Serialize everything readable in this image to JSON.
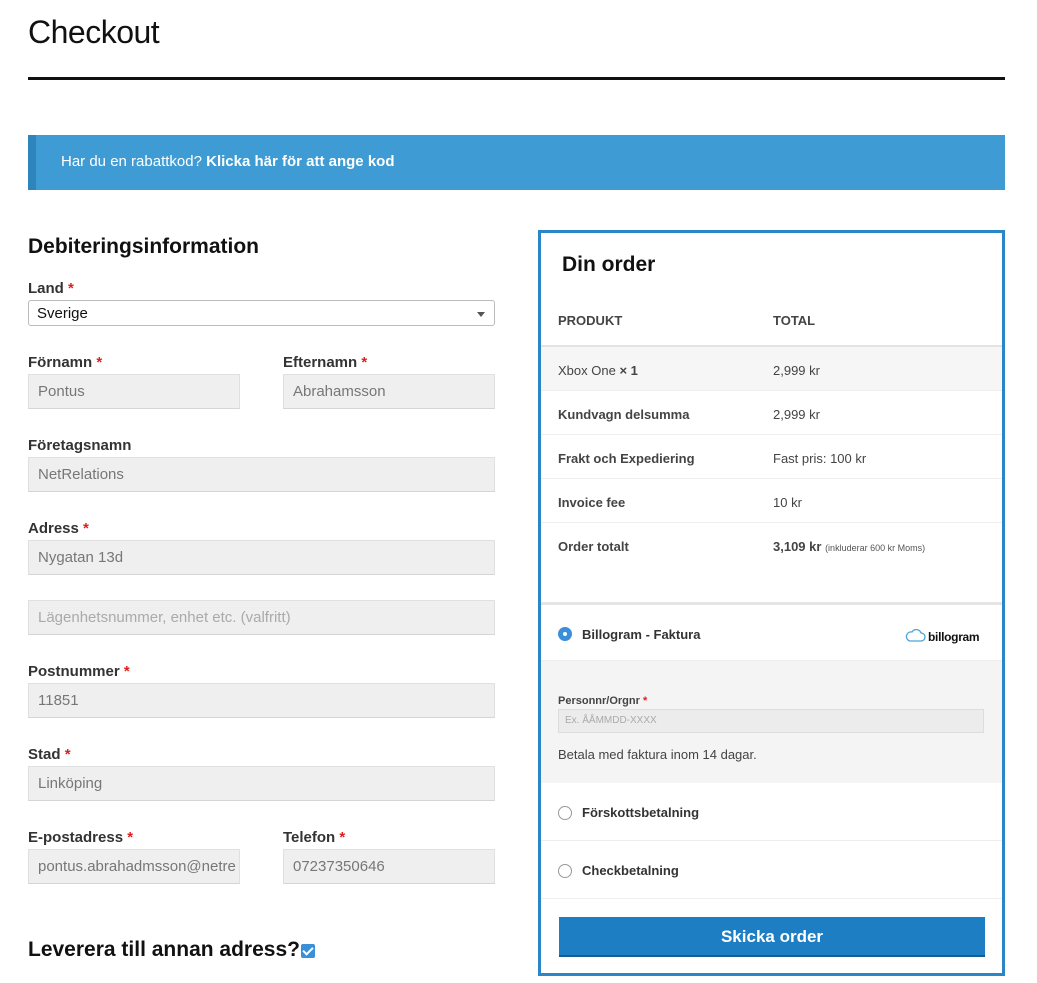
{
  "page": {
    "title": "Checkout"
  },
  "coupon": {
    "text": "Har du en rabattkod?",
    "link": "Klicka här för att ange kod"
  },
  "billing": {
    "heading": "Debiteringsinformation",
    "required_mark": "*",
    "country": {
      "label": "Land",
      "value": "Sverige"
    },
    "first_name": {
      "label": "Förnamn",
      "value": "Pontus"
    },
    "last_name": {
      "label": "Efternamn",
      "value": "Abrahamsson"
    },
    "company": {
      "label": "Företagsnamn",
      "value": "NetRelations"
    },
    "address": {
      "label": "Adress",
      "value": "Nygatan 13d"
    },
    "address2": {
      "placeholder": "Lägenhetsnummer, enhet etc. (valfritt)"
    },
    "postcode": {
      "label": "Postnummer",
      "value": "11851"
    },
    "city": {
      "label": "Stad",
      "value": "Linköping"
    },
    "email": {
      "label": "E-postadress",
      "value": "pontus.abrahadmsson@netre"
    },
    "phone": {
      "label": "Telefon",
      "value": "07237350646"
    }
  },
  "shipping": {
    "heading": "Leverera till annan adress?",
    "checked": true
  },
  "order": {
    "heading": "Din order",
    "columns": {
      "product": "PRODUKT",
      "total": "TOTAL"
    },
    "item": {
      "name": "Xbox One",
      "qty": "× 1",
      "total": "2,999 kr"
    },
    "subtotal": {
      "label": "Kundvagn delsumma",
      "value": "2,999 kr"
    },
    "shipping": {
      "label": "Frakt och Expediering",
      "value": "Fast pris: 100 kr"
    },
    "fee": {
      "label": "Invoice fee",
      "value": "10 kr"
    },
    "total": {
      "label": "Order totalt",
      "value": "3,109 kr",
      "note": "(inkluderar 600 kr Moms)"
    }
  },
  "payment": {
    "methods": [
      {
        "label": "Billogram - Faktura",
        "selected": true
      },
      {
        "label": "Förskottsbetalning",
        "selected": false
      },
      {
        "label": "Checkbetalning",
        "selected": false
      }
    ],
    "logo_text": "billogram",
    "id_label": "Personnr/Orgnr",
    "id_placeholder": "Ex. ÅÅMMDD-XXXX",
    "description": "Betala med faktura inom 14 dagar."
  },
  "submit_label": "Skicka order",
  "colors": {
    "accent": "#1e7ec4",
    "notice": "#3f9bd3",
    "required": "#e01d1d"
  }
}
